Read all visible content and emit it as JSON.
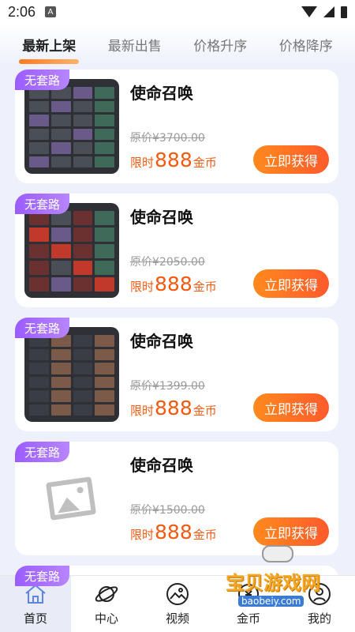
{
  "status_bar": {
    "time": "2:06",
    "notif_icon": "A"
  },
  "tabs": [
    {
      "label": "最新上架",
      "active": true
    },
    {
      "label": "最新出售",
      "active": false
    },
    {
      "label": "价格升序",
      "active": false
    },
    {
      "label": "价格降序",
      "active": false
    }
  ],
  "products": [
    {
      "badge": "无套路",
      "title": "使命召唤",
      "original_price": "原价¥3700.00",
      "price_label": "限时",
      "price": "888",
      "unit": "金币",
      "button": "立即获得"
    },
    {
      "badge": "无套路",
      "title": "使命召唤",
      "original_price": "原价¥2050.00",
      "price_label": "限时",
      "price": "888",
      "unit": "金币",
      "button": "立即获得"
    },
    {
      "badge": "无套路",
      "title": "使命召唤",
      "original_price": "原价¥1399.00",
      "price_label": "限时",
      "price": "888",
      "unit": "金币",
      "button": "立即获得"
    },
    {
      "badge": "无套路",
      "title": "使命召唤",
      "original_price": "原价¥1500.00",
      "price_label": "限时",
      "price": "888",
      "unit": "金币",
      "button": "立即获得"
    }
  ],
  "partial_card_badge": "无套路",
  "bottom_nav": [
    {
      "label": "首页",
      "icon": "home-icon",
      "active": true
    },
    {
      "label": "中心",
      "icon": "planet-icon",
      "active": false
    },
    {
      "label": "视频",
      "icon": "image-icon",
      "active": false
    },
    {
      "label": "金币",
      "icon": "coin-icon",
      "active": false
    },
    {
      "label": "我的",
      "icon": "user-icon",
      "active": false
    }
  ],
  "watermark": {
    "text": "宝贝游戏网",
    "url": "baobeiy.com"
  },
  "colors": {
    "accent": "#ff6a1c",
    "badge": "#9b5cff",
    "price": "#f25a12"
  }
}
